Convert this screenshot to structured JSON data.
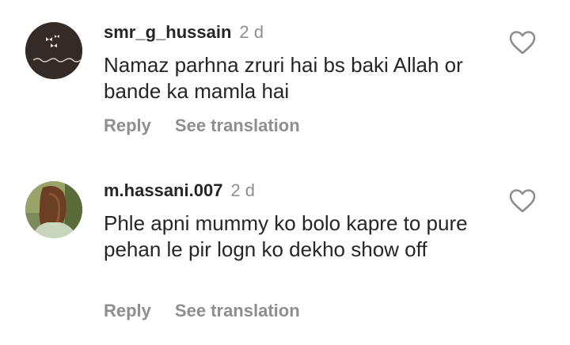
{
  "comments": [
    {
      "username": "smr_g_hussain",
      "time": "2 d",
      "text": "Namaz parhna zruri hai bs baki Allah or bande ka mamla hai",
      "reply_label": "Reply",
      "translate_label": "See translation",
      "like_icon": "heart-outline-icon"
    },
    {
      "username": "m.hassani.007",
      "time": "2 d",
      "text": "Phle apni mummy ko bolo kapre to pure pehan le pir logn ko dekho show off",
      "reply_label": "Reply",
      "translate_label": "See translation",
      "like_icon": "heart-outline-icon"
    }
  ],
  "colors": {
    "text": "#262626",
    "secondary": "#8e8e8e",
    "background": "#ffffff"
  }
}
